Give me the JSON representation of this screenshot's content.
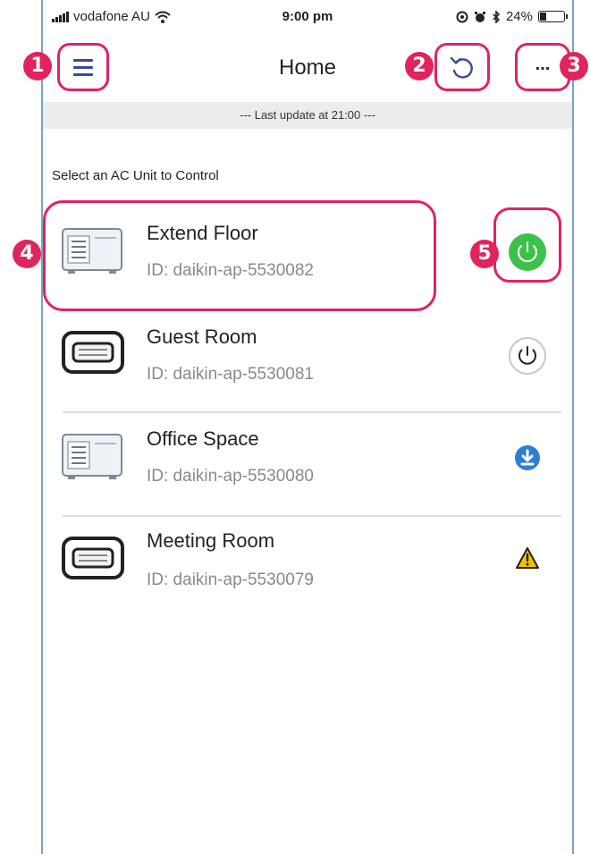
{
  "status_bar": {
    "carrier": "vodafone AU",
    "time": "9:00 pm",
    "battery": "24%"
  },
  "nav": {
    "title": "Home",
    "menu_icon": "hamburger-menu-icon",
    "refresh_icon": "refresh-icon",
    "more_label": "..."
  },
  "banner": "--- Last update at 21:00 ---",
  "prompt": "Select an  AC Unit to Control",
  "units": [
    {
      "name": "Extend Floor",
      "id": "ID: daikin-ap-5530082",
      "icon": "ac-unit-icon",
      "status": "power-on",
      "status_color": "#3cc24a"
    },
    {
      "name": "Guest Room",
      "id": "ID: daikin-ap-5530081",
      "icon": "ac-wall-unit-icon",
      "status": "power-off",
      "status_color": "#c8c8c8"
    },
    {
      "name": "Office Space",
      "id": "ID: daikin-ap-5530080",
      "icon": "ac-unit-icon",
      "status": "download",
      "status_color": "#2a7fd4"
    },
    {
      "name": "Meeting Room",
      "id": "ID: daikin-ap-5530079",
      "icon": "ac-wall-unit-icon",
      "status": "warning",
      "status_color": "#f2c200"
    }
  ],
  "callouts": [
    "1",
    "2",
    "3",
    "4",
    "5"
  ],
  "colors": {
    "highlight": "#e0245e",
    "frame": "#7aa3c8"
  }
}
